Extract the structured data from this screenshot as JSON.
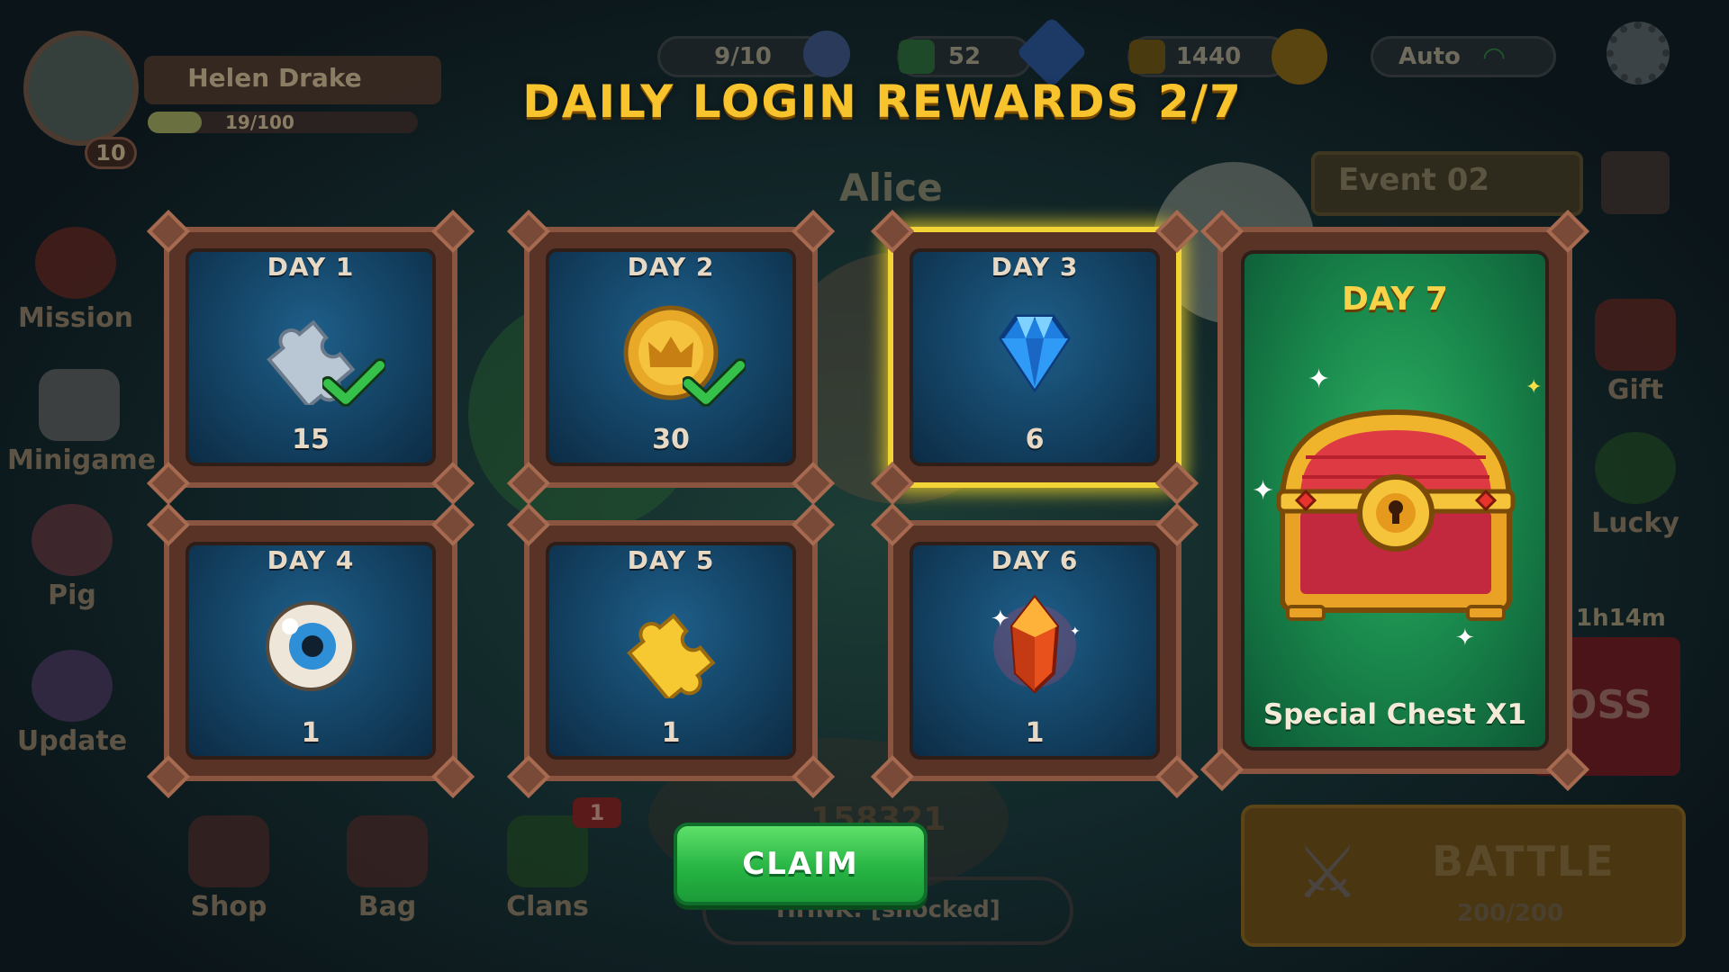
{
  "colors": {
    "title": "#f7c42e",
    "card_frame": "#8a5540",
    "card_bg": "#15476a",
    "selected_glow": "#f2d437",
    "day7_bg": "#1a8a4d",
    "claim_bg": "#27b544",
    "check": "#36c24a"
  },
  "header": {
    "player_name": "Helen Drake",
    "xp": "19/100",
    "level": "10",
    "energy": "9/10",
    "gems": "52",
    "coins": "1440",
    "auto_label": "Auto"
  },
  "background": {
    "npc_name": "Alice",
    "event_label": "Event 02",
    "timer": "1h14m",
    "boss_partial": "OSS",
    "score": "158321",
    "chat": "HHNK: [shocked]",
    "battle_label": "BATTLE",
    "battle_energy": "200/200",
    "clans_badge": "1"
  },
  "side_menu": [
    {
      "label": "Mission",
      "icon": "target-icon"
    },
    {
      "label": "Minigame",
      "icon": "dice-icon"
    },
    {
      "label": "Pig",
      "icon": "piggy-bank-icon"
    },
    {
      "label": "Update",
      "icon": "egg-icon"
    }
  ],
  "right_menu": [
    {
      "label": "Gift",
      "icon": "gift-icon"
    },
    {
      "label": "Lucky",
      "icon": "clover-icon"
    }
  ],
  "bottom_menu": [
    {
      "label": "Shop",
      "icon": "shop-icon"
    },
    {
      "label": "Bag",
      "icon": "bag-icon"
    },
    {
      "label": "Clans",
      "icon": "clan-shield-icon"
    }
  ],
  "dialog": {
    "title": "DAILY LOGIN REWARDS 2/7",
    "claim_label": "CLAIM",
    "days": [
      {
        "label": "DAY 1",
        "qty": "15",
        "icon": "puzzle-piece-icon",
        "claimed": true
      },
      {
        "label": "DAY 2",
        "qty": "30",
        "icon": "crown-coin-icon",
        "claimed": true
      },
      {
        "label": "DAY 3",
        "qty": "6",
        "icon": "blue-gem-icon",
        "claimed": false,
        "selected": true
      },
      {
        "label": "DAY 4",
        "qty": "1",
        "icon": "eyeball-icon",
        "claimed": false
      },
      {
        "label": "DAY 5",
        "qty": "1",
        "icon": "gold-puzzle-icon",
        "claimed": false
      },
      {
        "label": "DAY 6",
        "qty": "1",
        "icon": "red-crystal-icon",
        "claimed": false
      }
    ],
    "day7": {
      "label": "DAY 7",
      "desc": "Special Chest X1",
      "icon": "treasure-chest-icon"
    }
  }
}
